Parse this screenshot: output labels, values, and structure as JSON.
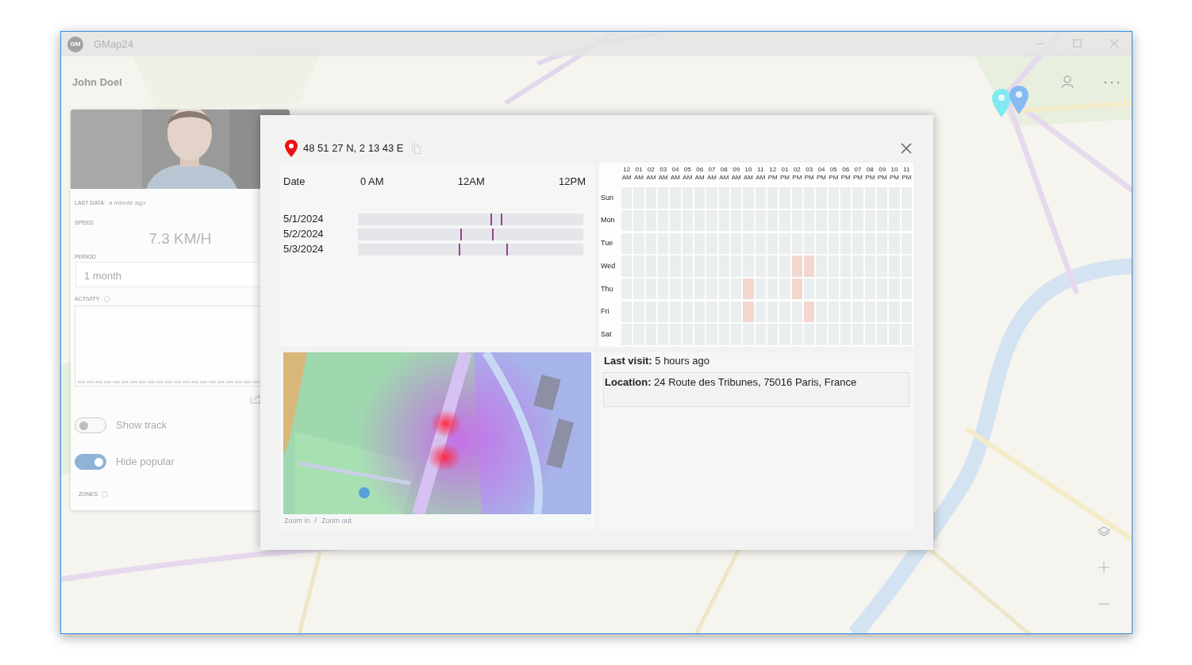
{
  "window": {
    "logo": "GM",
    "title": "GMap24"
  },
  "user": {
    "name": "John Doel"
  },
  "panel": {
    "last_data_label": "LAST DATA:",
    "last_data": "a minute ago",
    "speed_label": "SPEED",
    "speed": "7.3 KM/H",
    "period_label": "PERIOD",
    "period": "1 month",
    "activity_label": "ACTIVITY",
    "toggles": [
      {
        "label": "Show track",
        "on": false
      },
      {
        "label": "Hide popular",
        "on": true
      }
    ],
    "zones_label": "ZONES"
  },
  "map_pins": [
    {
      "color": "#80eaf0"
    },
    {
      "color": "#86baf2"
    }
  ],
  "dialog": {
    "coordinates": "48 51 27 N, 2 13 43 E",
    "timeline": {
      "columns": [
        "Date",
        "0 AM",
        "12AM",
        "12PM"
      ],
      "rows": [
        {
          "date": "5/1/2024",
          "visits": [
            {
              "level": 0.588
            },
            {
              "level": 0.634
            }
          ]
        },
        {
          "date": "5/2/2024",
          "visits": [
            {
              "level": 0.454
            },
            {
              "level": 0.595
            }
          ]
        },
        {
          "date": "5/3/2024",
          "visits": [
            {
              "level": 0.447
            },
            {
              "level": 0.658
            }
          ]
        }
      ]
    },
    "heatmap": {
      "hours": [
        {
          "hour": "12",
          "period": "AM"
        },
        {
          "hour": "01",
          "period": "AM"
        },
        {
          "hour": "02",
          "period": "AM"
        },
        {
          "hour": "03",
          "period": "AM"
        },
        {
          "hour": "04",
          "period": "AM"
        },
        {
          "hour": "05",
          "period": "AM"
        },
        {
          "hour": "06",
          "period": "AM"
        },
        {
          "hour": "07",
          "period": "AM"
        },
        {
          "hour": "08",
          "period": "AM"
        },
        {
          "hour": "09",
          "period": "AM"
        },
        {
          "hour": "10",
          "period": "AM"
        },
        {
          "hour": "11",
          "period": "AM"
        },
        {
          "hour": "12",
          "period": "PM"
        },
        {
          "hour": "01",
          "period": "PM"
        },
        {
          "hour": "02",
          "period": "PM"
        },
        {
          "hour": "03",
          "period": "PM"
        },
        {
          "hour": "04",
          "period": "PM"
        },
        {
          "hour": "05",
          "period": "PM"
        },
        {
          "hour": "06",
          "period": "PM"
        },
        {
          "hour": "07",
          "period": "PM"
        },
        {
          "hour": "08",
          "period": "PM"
        },
        {
          "hour": "09",
          "period": "PM"
        },
        {
          "hour": "10",
          "period": "PM"
        },
        {
          "hour": "11",
          "period": "PM"
        }
      ],
      "days": [
        {
          "day": "Sun",
          "active": [
            false,
            false,
            false,
            false,
            false,
            false,
            false,
            false,
            false,
            false,
            false,
            false,
            false,
            false,
            false,
            false,
            false,
            false,
            false,
            false,
            false,
            false,
            false,
            false
          ]
        },
        {
          "day": "Mon",
          "active": [
            false,
            false,
            false,
            false,
            false,
            false,
            false,
            false,
            false,
            false,
            false,
            false,
            false,
            false,
            false,
            false,
            false,
            false,
            false,
            false,
            false,
            false,
            false,
            false
          ]
        },
        {
          "day": "Tue",
          "active": [
            false,
            false,
            false,
            false,
            false,
            false,
            false,
            false,
            false,
            false,
            false,
            false,
            false,
            false,
            false,
            false,
            false,
            false,
            false,
            false,
            false,
            false,
            false,
            false
          ]
        },
        {
          "day": "Wed",
          "active": [
            false,
            false,
            false,
            false,
            false,
            false,
            false,
            false,
            false,
            false,
            false,
            false,
            false,
            false,
            true,
            true,
            false,
            false,
            false,
            false,
            false,
            false,
            false,
            false
          ]
        },
        {
          "day": "Thu",
          "active": [
            false,
            false,
            false,
            false,
            false,
            false,
            false,
            false,
            false,
            false,
            true,
            false,
            false,
            false,
            true,
            false,
            false,
            false,
            false,
            false,
            false,
            false,
            false,
            false
          ]
        },
        {
          "day": "Fri",
          "active": [
            false,
            false,
            false,
            false,
            false,
            false,
            false,
            false,
            false,
            false,
            true,
            false,
            false,
            false,
            false,
            true,
            false,
            false,
            false,
            false,
            false,
            false,
            false,
            false
          ]
        },
        {
          "day": "Sat",
          "active": [
            false,
            false,
            false,
            false,
            false,
            false,
            false,
            false,
            false,
            false,
            false,
            false,
            false,
            false,
            false,
            false,
            false,
            false,
            false,
            false,
            false,
            false,
            false,
            false
          ]
        }
      ]
    },
    "zoom_links": [
      "Zoom in",
      "Zoom out"
    ],
    "separator": "/",
    "last_visit": "**Last visit:** 5 hours ago",
    "location": "**Location:** 24 Route des Tribunes, 75016 Paris, France"
  }
}
